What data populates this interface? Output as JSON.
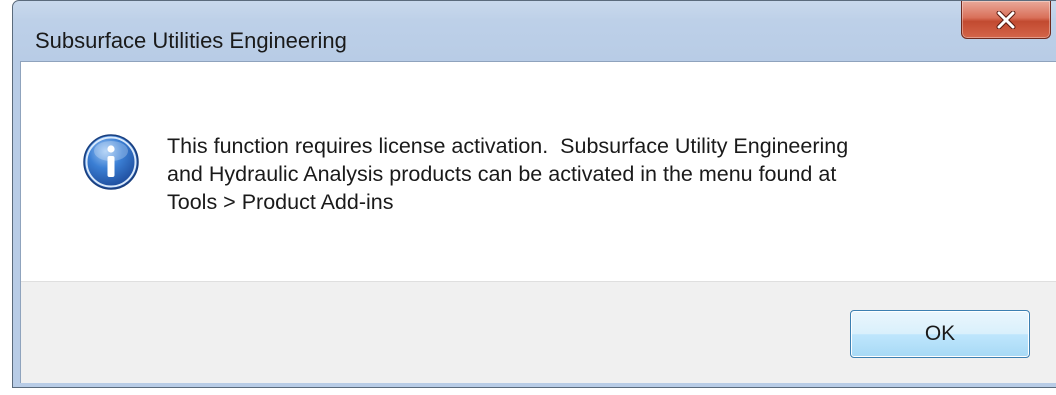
{
  "window": {
    "title": "Subsurface Utilities Engineering",
    "close_icon": "close-x-icon"
  },
  "message": {
    "icon": "info-icon",
    "text": "This function requires license activation.  Subsurface Utility Engineering\nand Hydraulic Analysis products can be activated in the menu found at\nTools > Product Add-ins"
  },
  "buttons": {
    "ok_label": "OK"
  },
  "colors": {
    "titlebar": "#bdd0e8",
    "close_button": "#c24a30",
    "button_area": "#f0f0f0",
    "ok_border": "#3c7fb1"
  }
}
